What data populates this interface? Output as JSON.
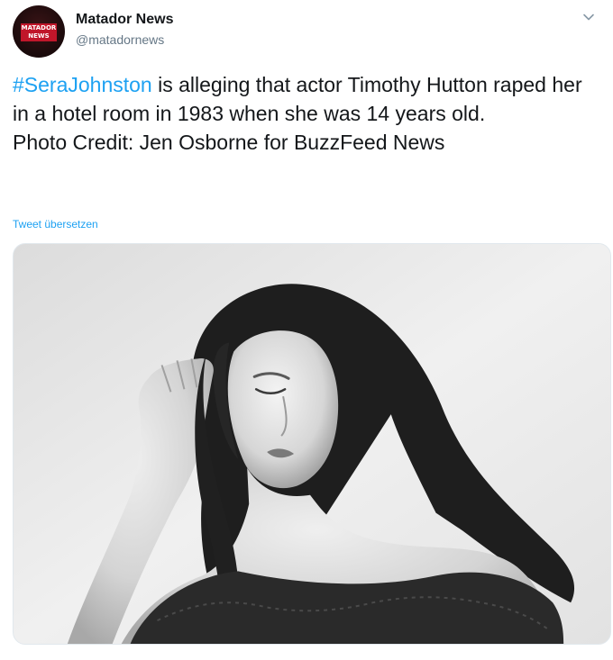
{
  "author": {
    "name": "Matador News",
    "handle": "@matadornews",
    "avatar_logo_line1": "MATADOR",
    "avatar_logo_line2": "NEWS",
    "avatar_icon": "matador-logo-icon"
  },
  "tweet": {
    "hashtag": "#SeraJohnston",
    "text_line1_rest": " is alleging that actor Timothy Hutton raped her in a hotel room in 1983 when she was 14 years old.",
    "text_line2": "Photo Credit: Jen Osborne for BuzzFeed News",
    "translate_link": "Tweet übersetzen"
  },
  "menu": {
    "icon": "chevron-down-icon"
  },
  "media": {
    "type": "photo",
    "description_icon": "photo-image"
  },
  "colors": {
    "link": "#1da1f2",
    "text": "#14171a",
    "secondary_text": "#657786",
    "avatar_red": "#c0162a"
  }
}
